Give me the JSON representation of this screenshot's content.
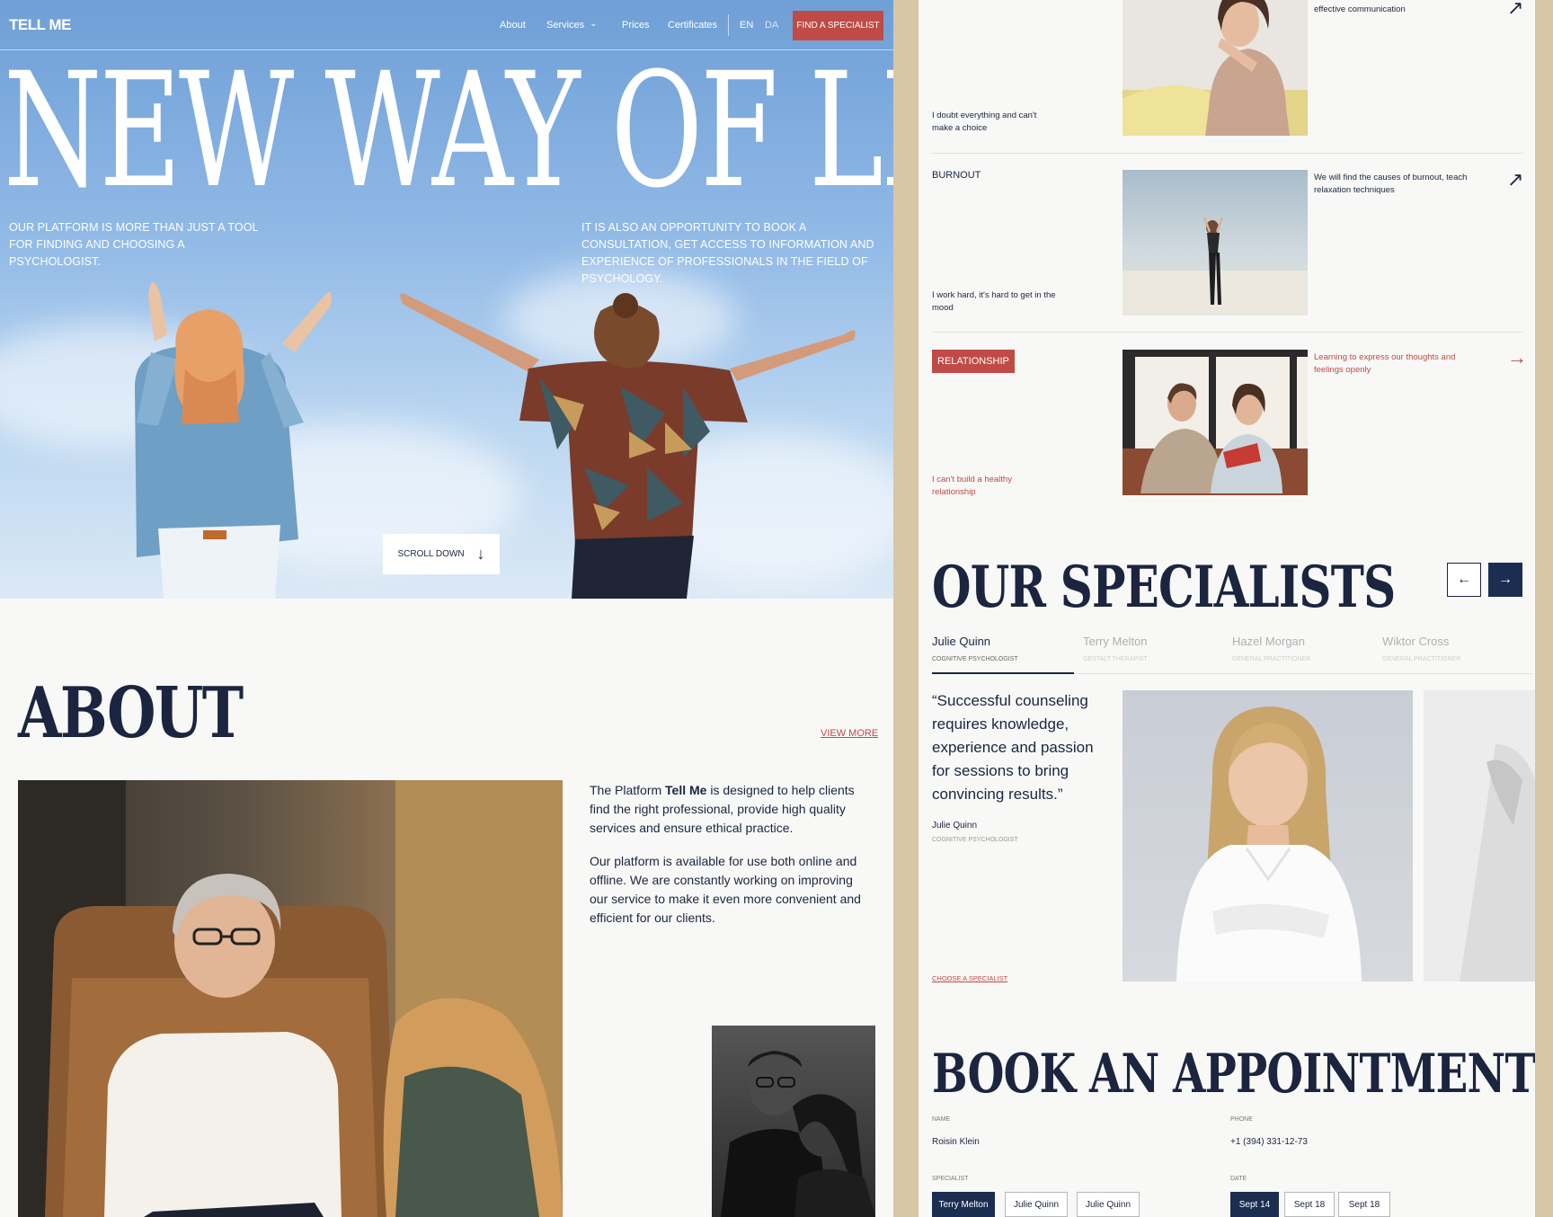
{
  "nav": {
    "logo": "TELL ME",
    "about": "About",
    "services": "Services",
    "prices": "Prices",
    "certificates": "Certificates",
    "lang_en": "EN",
    "lang_da": "DA",
    "cta": "FIND A SPECIALIST"
  },
  "hero": {
    "title": "NEW WAY OF LIFE",
    "copy_left": "OUR PLATFORM IS MORE THAN JUST A TOOL FOR FINDING AND CHOOSING A PSYCHOLOGIST.",
    "copy_right": "IT IS ALSO AN OPPORTUNITY TO BOOK A CONSULTATION, GET ACCESS TO INFORMATION AND EXPERIENCE OF PROFESSIONALS IN THE FIELD OF PSYCHOLOGY.",
    "scroll_label": "SCROLL DOWN"
  },
  "about": {
    "title": "ABOUT",
    "view_more": "VIEW MORE",
    "p1_pre": "The Platform ",
    "p1_brand": "Tell Me",
    "p1_post": " is designed to help clients find the right professional, provide high quality services and ensure ethical practice.",
    "p2": "Our platform is available for use both online and offline. We are constantly working on improving our service to make it even more convenient and efficient for our clients."
  },
  "issues": [
    {
      "title": "",
      "desc": "I doubt everything and can't make a choice",
      "note": "effective communication",
      "arrow": "↗",
      "highlighted": false
    },
    {
      "title": "BURNOUT",
      "desc": "I work hard, it's hard to get in the mood",
      "note": "We will find the causes of burnout, teach relaxation techniques",
      "arrow": "↗",
      "highlighted": false
    },
    {
      "title": "RELATIONSHIP",
      "desc": "I can't build a healthy relationship",
      "note": "Learning to express our thoughts and feelings openly",
      "arrow": "→",
      "highlighted": true
    }
  ],
  "specialists": {
    "title": "OUR SPECIALISTS",
    "prev": "←",
    "next": "→",
    "tabs": [
      {
        "name": "Julie Quinn",
        "role": "Cognitive psychologist"
      },
      {
        "name": "Terry Melton",
        "role": "Gestalt therapist"
      },
      {
        "name": "Hazel Morgan",
        "role": "General practitioner"
      },
      {
        "name": "Wiktor Cross",
        "role": "General practitioner"
      }
    ],
    "quote": "“Successful counseling requires knowledge, experience and passion for sessions to bring convincing results.”",
    "quote_name": "Julie Quinn",
    "quote_role": "Cognitive psychologist",
    "choose": "CHOOSE A SPECIALIST"
  },
  "booking": {
    "title": "BOOK AN APPOINTMENT",
    "name_label": "NAME",
    "name_value": "Roisin Klein",
    "phone_label": "PHONE",
    "phone_value": "+1 (394) 331-12-73",
    "specialist_label": "SPECIALIST",
    "specialist_options": [
      "Terry Melton",
      "Julie Quinn",
      "Julie Quinn"
    ],
    "date_label": "DATE",
    "date_options": [
      "Sept 14",
      "Sept 18",
      "Sept 18"
    ]
  },
  "colors": {
    "accent": "#c04a45",
    "navy": "#1b2e52",
    "panel": "#f8f8f7",
    "frame": "#d9c6a4"
  }
}
